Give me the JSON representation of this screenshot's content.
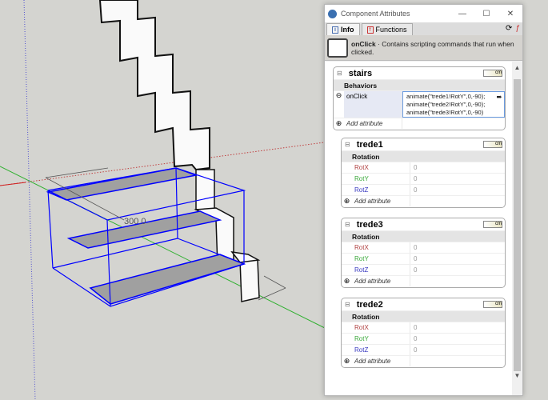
{
  "window": {
    "title": "Component Attributes",
    "minimize": "—",
    "maximize": "☐",
    "close": "✕"
  },
  "tabs": [
    {
      "label": "Info",
      "icon": "info-icon"
    },
    {
      "label": "Functions",
      "icon": "functions-icon"
    }
  ],
  "help": {
    "term": "onClick",
    "text": " · Contains scripting commands that run when clicked."
  },
  "viewport": {
    "dimension_label": "300.0"
  },
  "components": [
    {
      "name": "stairs",
      "badge": "cm",
      "group": "Behaviors",
      "rows": [
        {
          "key": "onClick",
          "lines": [
            "animate(\"trede1!RotY\",0,-90);",
            "animate(\"trede2!RotY\",0,-90);",
            "animate(\"trede3!RotY\",0,-90)"
          ]
        }
      ],
      "add": "Add attribute"
    },
    {
      "name": "trede1",
      "badge": "cm",
      "group": "Rotation",
      "rows": [
        {
          "key": "RotX",
          "value": "0"
        },
        {
          "key": "RotY",
          "value": "0"
        },
        {
          "key": "RotZ",
          "value": "0"
        }
      ],
      "add": "Add attribute"
    },
    {
      "name": "trede3",
      "badge": "cm",
      "group": "Rotation",
      "rows": [
        {
          "key": "RotX",
          "value": "0"
        },
        {
          "key": "RotY",
          "value": "0"
        },
        {
          "key": "RotZ",
          "value": "0"
        }
      ],
      "add": "Add attribute"
    },
    {
      "name": "trede2",
      "badge": "cm",
      "group": "Rotation",
      "rows": [
        {
          "key": "RotX",
          "value": "0"
        },
        {
          "key": "RotY",
          "value": "0"
        },
        {
          "key": "RotZ",
          "value": "0"
        }
      ],
      "add": "Add attribute"
    }
  ],
  "colors": {
    "rotx": "#b04040",
    "roty": "#3aa83a",
    "rotz": "#3a3ac0",
    "selection": "#0000ff"
  }
}
